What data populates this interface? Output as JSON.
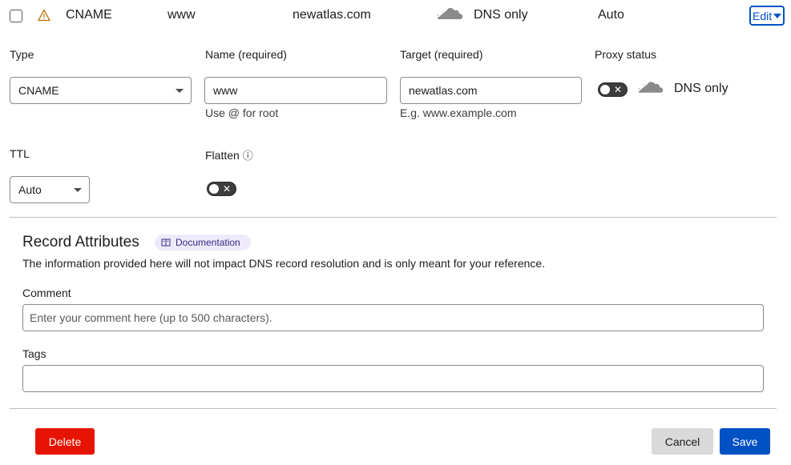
{
  "record_row": {
    "type": "CNAME",
    "name": "www",
    "content": "newatlas.com",
    "proxy_status": "DNS only",
    "ttl": "Auto",
    "edit_label": "Edit"
  },
  "form": {
    "type_label": "Type",
    "type_value": "CNAME",
    "name_label": "Name (required)",
    "name_value": "www",
    "name_hint": "Use @ for root",
    "target_label": "Target (required)",
    "target_value": "newatlas.com",
    "target_hint": "E.g. www.example.com",
    "proxy_label": "Proxy status",
    "proxy_value": "DNS only",
    "ttl_label": "TTL",
    "ttl_value": "Auto",
    "flatten_label": "Flatten",
    "flatten_info_glyph": "ⓘ"
  },
  "attributes": {
    "title": "Record Attributes",
    "doc_label": "Documentation",
    "description": "The information provided here will not impact DNS record resolution and is only meant for your reference.",
    "comment_label": "Comment",
    "comment_placeholder": "Enter your comment here (up to 500 characters).",
    "tags_label": "Tags",
    "tags_value": ""
  },
  "actions": {
    "delete_label": "Delete",
    "cancel_label": "Cancel",
    "save_label": "Save"
  },
  "toggle_glyph": "✕",
  "colors": {
    "primary": "#0051c3",
    "danger": "#e81403",
    "secondary": "#d9d9d9",
    "warning": "#b86a00"
  }
}
